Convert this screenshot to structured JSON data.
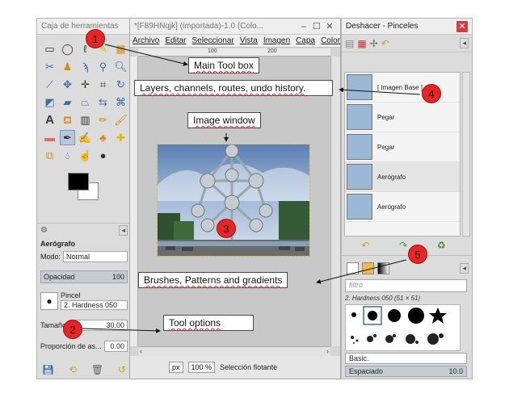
{
  "toolbox": {
    "title": "Caja de herramientas",
    "options": {
      "tool_name": "Aerógrafo",
      "mode_label": "Modo:",
      "mode_value": "Normal",
      "opacity_label": "Opacidad",
      "opacity_value": "100",
      "brush_label": "Pincel",
      "brush_value": "2. Hardness 050",
      "size_label": "Tamaño",
      "size_value": "30.00",
      "aspect_label": "Proporción de as...",
      "aspect_value": "0.00"
    }
  },
  "image_window": {
    "title": "*[F89HNqjk] (importada)-1.0 (Colo...",
    "menu": [
      "Archivo",
      "Editar",
      "Seleccionar",
      "Vista",
      "Imagen",
      "Capa",
      "Colores"
    ],
    "ruler_ticks": [
      "100",
      "200"
    ],
    "status": {
      "unit": "px",
      "zoom": "100 %",
      "message": "Selección flotante"
    }
  },
  "dock": {
    "title": "Deshacer - Pinceles",
    "history": [
      {
        "label": "[ Imagen Base ]"
      },
      {
        "label": "Pegar"
      },
      {
        "label": "Pegar"
      },
      {
        "label": "Aerógrafo"
      },
      {
        "label": "Aerógrafo"
      }
    ],
    "brushes": {
      "filter_placeholder": "filtro",
      "selected_brush": "2. Hardness 050 (51 × 51)",
      "tag": "Basic.",
      "spacing_label": "Espaciado",
      "spacing_value": "10.0"
    }
  },
  "callouts": {
    "main_toolbox": "Main Tool box",
    "layers": "Layers, channels, routes, undo history.",
    "image_window": "Image window",
    "brushes": "Brushes, Patterns and gradients",
    "tool_options": "Tool options"
  },
  "markers": [
    "1",
    "2",
    "3",
    "4",
    "5"
  ],
  "colors": {
    "marker_red": "#e82525",
    "fg_color": "#000000",
    "bg_color": "#ffffff"
  }
}
